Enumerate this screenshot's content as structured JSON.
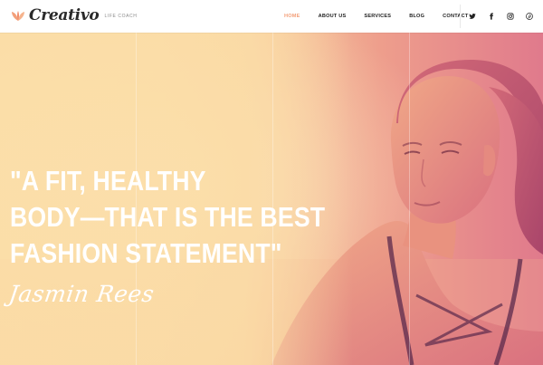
{
  "brand": {
    "name": "Creativo",
    "tagline": "LIFE COACH",
    "logo_icon": "lotus-leaf-icon",
    "accent_color": "#f3a07a"
  },
  "nav": {
    "items": [
      {
        "label": "HOME",
        "active": true
      },
      {
        "label": "ABOUT US",
        "active": false
      },
      {
        "label": "SERVICES",
        "active": false
      },
      {
        "label": "BLOG",
        "active": false
      },
      {
        "label": "CONTACT",
        "active": false
      }
    ]
  },
  "social": {
    "icons": [
      "twitter-icon",
      "facebook-icon",
      "instagram-icon",
      "pinterest-icon"
    ]
  },
  "hero": {
    "quote_lines": [
      "\"A FIT, HEALTHY",
      "BODY—THAT IS THE BEST",
      "FASHION STATEMENT\""
    ],
    "author": "Jasmin Rees",
    "overlay_colors": [
      "#fbe1a9",
      "#f5c39a",
      "#ee9e8c",
      "#e07a8c"
    ]
  }
}
